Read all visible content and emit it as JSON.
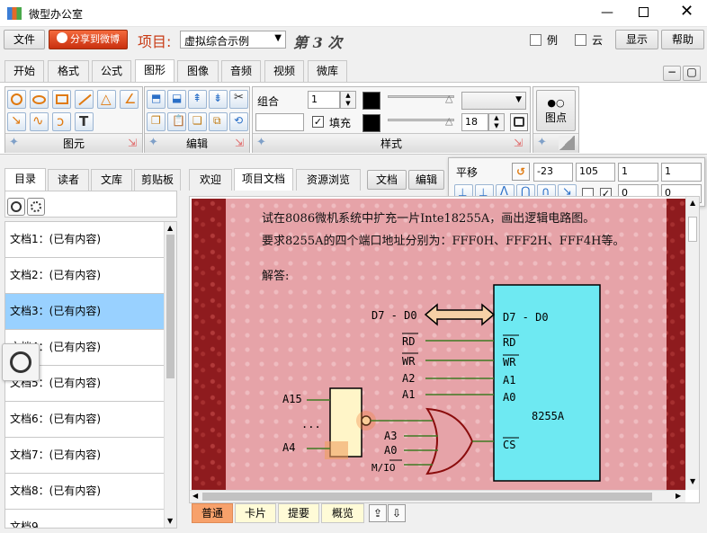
{
  "window": {
    "title": "微型办公室"
  },
  "toolbar": {
    "file_label": "文件",
    "share_label": "分享到微博",
    "project_prefix": "项目:",
    "project_value": "虚拟综合示例",
    "episode": "第 3 次",
    "check1_label": "例",
    "check2_label": "云",
    "show_label": "显示",
    "help_label": "帮助"
  },
  "ribbon_tabs": [
    "开始",
    "格式",
    "公式",
    "图形",
    "图像",
    "音频",
    "视频",
    "微库"
  ],
  "ribbon": {
    "group_shapes": "图元",
    "group_edit": "编辑",
    "group_style": "样式",
    "combo_label": "组合",
    "combo_value": "1",
    "fill_label": "填充",
    "fill_checked": true,
    "size_value": "18",
    "point_label": "图点"
  },
  "transform": {
    "label": "平移",
    "values": [
      "-23",
      "105",
      "1",
      "1",
      "0",
      "0"
    ]
  },
  "left_tabs": [
    "目录",
    "读者",
    "文库",
    "剪贴板"
  ],
  "doc_list": [
    "文档1：(已有内容)",
    "文档2：(已有内容)",
    "文档3：(已有内容)",
    "文档4：(已有内容)",
    "文档5：(已有内容)",
    "文档6：(已有内容)",
    "文档7：(已有内容)",
    "文档8：(已有内容)",
    "文档9"
  ],
  "content_tabs": [
    "欢迎",
    "项目文档",
    "资源浏览"
  ],
  "content_buttons": [
    "文档",
    "编辑"
  ],
  "document": {
    "line1": "试在8086微机系统中扩充一片Inte18255A，画出逻辑电路图。",
    "line2": "要求8255A的四个端口地址分别为：FFF0H、FFF2H、FFF4H等。",
    "answer": "解答:",
    "chip_name": "8255A",
    "bus_label": "D7 - D0",
    "pins_right": [
      "D7 - D0",
      "RD",
      "WR",
      "A1",
      "A0",
      "CS"
    ],
    "signals_left": [
      "RD",
      "WR",
      "A2",
      "A1"
    ],
    "addr_labels": [
      "A15",
      "...",
      "A4"
    ],
    "gate_inputs": [
      "A3",
      "A0",
      "M/IO"
    ]
  },
  "bottom_tabs": [
    "普通",
    "卡片",
    "提要",
    "概览"
  ]
}
